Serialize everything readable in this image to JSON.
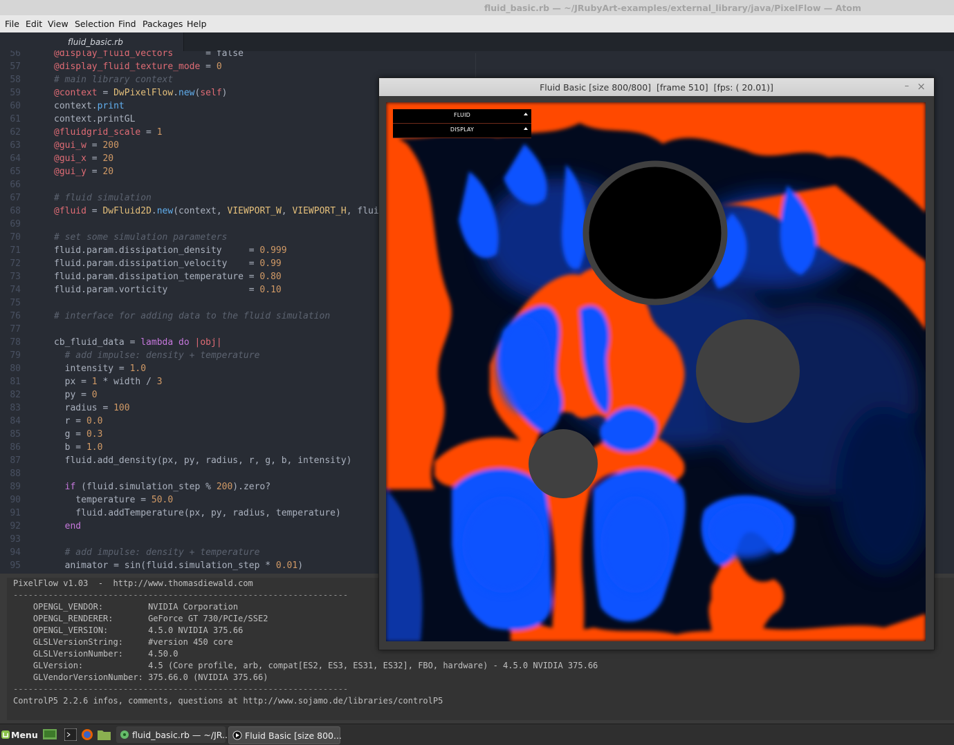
{
  "window": {
    "title": "fluid_basic.rb — ~/JRubyArt-examples/external_library/java/PixelFlow — Atom"
  },
  "menu": [
    "File",
    "Edit",
    "View",
    "Selection",
    "Find",
    "Packages",
    "Help"
  ],
  "editor": {
    "tab_label": "fluid_basic.rb",
    "lines": [
      {
        "n": "56",
        "t": "@display_fluid_vectors      = false"
      },
      {
        "n": "57",
        "t": "@display_fluid_texture_mode = 0"
      },
      {
        "n": "58",
        "t": "# main library context"
      },
      {
        "n": "59",
        "t": "@context = DwPixelFlow.new(self)"
      },
      {
        "n": "60",
        "t": "context.print"
      },
      {
        "n": "61",
        "t": "context.printGL"
      },
      {
        "n": "62",
        "t": "@fluidgrid_scale = 1"
      },
      {
        "n": "63",
        "t": "@gui_w = 200"
      },
      {
        "n": "64",
        "t": "@gui_x = 20"
      },
      {
        "n": "65",
        "t": "@gui_y = 20"
      },
      {
        "n": "66",
        "t": ""
      },
      {
        "n": "67",
        "t": "# fluid simulation"
      },
      {
        "n": "68",
        "t": "@fluid = DwFluid2D.new(context, VIEWPORT_W, VIEWPORT_H, flui"
      },
      {
        "n": "69",
        "t": ""
      },
      {
        "n": "70",
        "t": "# set some simulation parameters"
      },
      {
        "n": "71",
        "t": "fluid.param.dissipation_density     = 0.999"
      },
      {
        "n": "72",
        "t": "fluid.param.dissipation_velocity    = 0.99"
      },
      {
        "n": "73",
        "t": "fluid.param.dissipation_temperature = 0.80"
      },
      {
        "n": "74",
        "t": "fluid.param.vorticity               = 0.10"
      },
      {
        "n": "75",
        "t": ""
      },
      {
        "n": "76",
        "t": "# interface for adding data to the fluid simulation"
      },
      {
        "n": "77",
        "t": ""
      },
      {
        "n": "78",
        "t": "cb_fluid_data = lambda do |obj|"
      },
      {
        "n": "79",
        "t": "  # add impulse: density + temperature"
      },
      {
        "n": "80",
        "t": "  intensity = 1.0"
      },
      {
        "n": "81",
        "t": "  px = 1 * width / 3"
      },
      {
        "n": "82",
        "t": "  py = 0"
      },
      {
        "n": "83",
        "t": "  radius = 100"
      },
      {
        "n": "84",
        "t": "  r = 0.0"
      },
      {
        "n": "85",
        "t": "  g = 0.3"
      },
      {
        "n": "86",
        "t": "  b = 1.0"
      },
      {
        "n": "87",
        "t": "  fluid.add_density(px, py, radius, r, g, b, intensity)"
      },
      {
        "n": "88",
        "t": ""
      },
      {
        "n": "89",
        "t": "  if (fluid.simulation_step % 200).zero?"
      },
      {
        "n": "90",
        "t": "    temperature = 50.0"
      },
      {
        "n": "91",
        "t": "    fluid.addTemperature(px, py, radius, temperature)"
      },
      {
        "n": "92",
        "t": "  end"
      },
      {
        "n": "93",
        "t": ""
      },
      {
        "n": "94",
        "t": "  # add impulse: density + temperature"
      },
      {
        "n": "95",
        "t": "  animator = sin(fluid.simulation_step * 0.01)"
      }
    ]
  },
  "console": {
    "lines": [
      "PixelFlow v1.03  -  http://www.thomasdiewald.com",
      "-------------------------------------------------------------------",
      "    OPENGL_VENDOR:         NVIDIA Corporation",
      "    OPENGL_RENDERER:       GeForce GT 730/PCIe/SSE2",
      "    OPENGL_VERSION:        4.5.0 NVIDIA 375.66",
      "    GLSLVersionString:     #version 450 core",
      "    GLSLVersionNumber:     4.50.0",
      "    GLVersion:             4.5 (Core profile, arb, compat[ES2, ES3, ES31, ES32], FBO, hardware) - 4.5.0 NVIDIA 375.66",
      "    GLVendorVersionNumber: 375.66.0 (NVIDIA 375.66)",
      "-------------------------------------------------------------------",
      "ControlP5 2.2.6 infos, comments, questions at http://www.sojamo.de/libraries/controlP5"
    ]
  },
  "sketch": {
    "title": "Fluid Basic [size 800/800]  [frame 510]  [fps: ( 20.01)]",
    "controls": [
      "FLUID",
      "DISPLAY"
    ],
    "minimize": "–",
    "close": "×"
  },
  "taskbar": {
    "menu_label": "Menu",
    "windows": [
      "fluid_basic.rb — ~/JR...",
      "Fluid Basic [size 800..."
    ]
  },
  "colors": {
    "orange": "#ff4a00",
    "blue": "#0b52ff",
    "obstacle": "#404040"
  }
}
